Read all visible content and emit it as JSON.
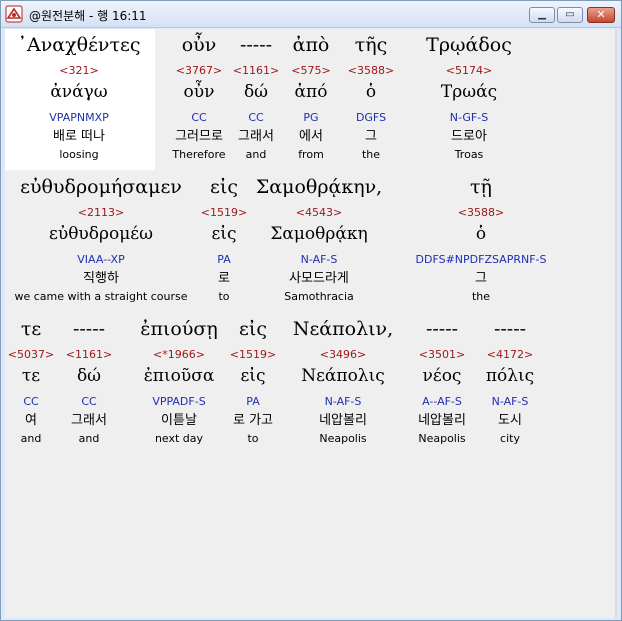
{
  "window": {
    "title": "@원전분해 - 행 16:11"
  },
  "rows": [
    {
      "words": [
        {
          "greek": "᾿Αναχθέντες",
          "strong": "<321>",
          "lemma": "ἀνάγω",
          "morph": "VPAPNMXP",
          "korean": "배로 떠나",
          "english": "loosing"
        },
        {
          "greek": "οὖν",
          "strong": "<3767>",
          "lemma": "οὖν",
          "morph": "CC",
          "korean": "그러므로",
          "english": "Therefore"
        },
        {
          "greek": "-----",
          "strong": "<1161>",
          "lemma": "δώ",
          "morph": "CC",
          "korean": "그래서",
          "english": "and"
        },
        {
          "greek": "ἀπὸ",
          "strong": "<575>",
          "lemma": "ἀπό",
          "morph": "PG",
          "korean": "에서",
          "english": "from"
        },
        {
          "greek": "τῆς",
          "strong": "<3588>",
          "lemma": "ὁ",
          "morph": "DGFS",
          "korean": "그",
          "english": "the"
        },
        {
          "greek": "Τρῳάδος",
          "strong": "<5174>",
          "lemma": "Τρωάς",
          "morph": "N-GF-S",
          "korean": "드로아",
          "english": "Troas"
        }
      ]
    },
    {
      "words": [
        {
          "greek": "εὐθυδρομήσαμεν",
          "strong": "<2113>",
          "lemma": "εὐθυδρομέω",
          "morph": "VIAA--XP",
          "korean": "직행하",
          "english": "we came with a straight course"
        },
        {
          "greek": "εἰς",
          "strong": "<1519>",
          "lemma": "εἰς",
          "morph": "PA",
          "korean": "로",
          "english": "to"
        },
        {
          "greek": "Σαμοθρᾴκην,",
          "strong": "<4543>",
          "lemma": "Σαμοθρᾴκη",
          "morph": "N-AF-S",
          "korean": "사모드라게",
          "english": "Samothracia"
        },
        {
          "greek": "τῇ",
          "strong": "<3588>",
          "lemma": "ὁ",
          "morph": "DDFS#NPDFZSAPRNF-S",
          "korean": "그",
          "english": "the"
        }
      ]
    },
    {
      "words": [
        {
          "greek": "τε",
          "strong": "<5037>",
          "lemma": "τε",
          "morph": "CC",
          "korean": "여",
          "english": "and"
        },
        {
          "greek": "-----",
          "strong": "<1161>",
          "lemma": "δώ",
          "morph": "CC",
          "korean": "그래서",
          "english": "and"
        },
        {
          "greek": "ἐπιούσῃ",
          "strong": "<*1966>",
          "lemma": "ἐπιοῦσα",
          "morph": "VPPADF-S",
          "korean": "이튿날",
          "english": "next day"
        },
        {
          "greek": "εἰς",
          "strong": "<1519>",
          "lemma": "εἰς",
          "morph": "PA",
          "korean": "로 가고",
          "english": "to"
        },
        {
          "greek": "Νεάπολιν,",
          "strong": "<3496>",
          "lemma": "Νεάπολις",
          "morph": "N-AF-S",
          "korean": "네압볼리",
          "english": "Neapolis"
        },
        {
          "greek": "-----",
          "strong": "<3501>",
          "lemma": "νέος",
          "morph": "A--AF-S",
          "korean": "네압볼리",
          "english": "Neapolis"
        },
        {
          "greek": "-----",
          "strong": "<4172>",
          "lemma": "πόλις",
          "morph": "N-AF-S",
          "korean": "도시",
          "english": "city"
        }
      ]
    }
  ]
}
